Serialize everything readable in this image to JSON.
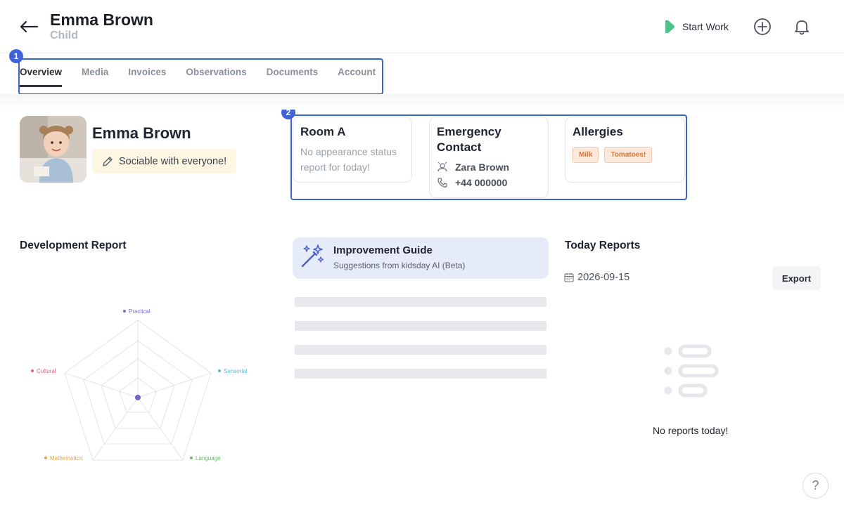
{
  "header": {
    "title": "Emma Brown",
    "subtitle": "Child",
    "start_work_label": "Start Work",
    "brand_color": "#4cc38a"
  },
  "tabs": [
    {
      "label": "Overview",
      "active": true
    },
    {
      "label": "Media",
      "active": false
    },
    {
      "label": "Invoices",
      "active": false
    },
    {
      "label": "Observations",
      "active": false
    },
    {
      "label": "Documents",
      "active": false
    },
    {
      "label": "Account",
      "active": false
    }
  ],
  "highlights": [
    {
      "number": "1"
    },
    {
      "number": "2"
    }
  ],
  "profile": {
    "name": "Emma Brown",
    "mood": "Sociable with everyone!"
  },
  "room_card": {
    "title": "Room A",
    "status": "No appearance status report for today!"
  },
  "emergency_card": {
    "title": "Emergency Contact",
    "contact_name": "Zara Brown",
    "contact_phone": "+44 000000"
  },
  "allergies_card": {
    "title": "Allergies",
    "tags": [
      "Milk",
      "Tomatoes!"
    ]
  },
  "development": {
    "title": "Development Report",
    "axes": [
      {
        "label": "Practical",
        "color": "#7a6fc4"
      },
      {
        "label": "Sensorial",
        "color": "#5fb8c9"
      },
      {
        "label": "Language",
        "color": "#6cb86c"
      },
      {
        "label": "Mathematics:",
        "color": "#e0a24a"
      },
      {
        "label": "Cultural",
        "color": "#e05a8a"
      }
    ]
  },
  "guide": {
    "title": "Improvement Guide",
    "subtitle": "Suggestions from kidsday AI (Beta)"
  },
  "reports": {
    "title": "Today Reports",
    "date": "2026-09-15",
    "export_label": "Export",
    "empty_text": "No reports today!"
  },
  "help": {
    "label": "?"
  }
}
